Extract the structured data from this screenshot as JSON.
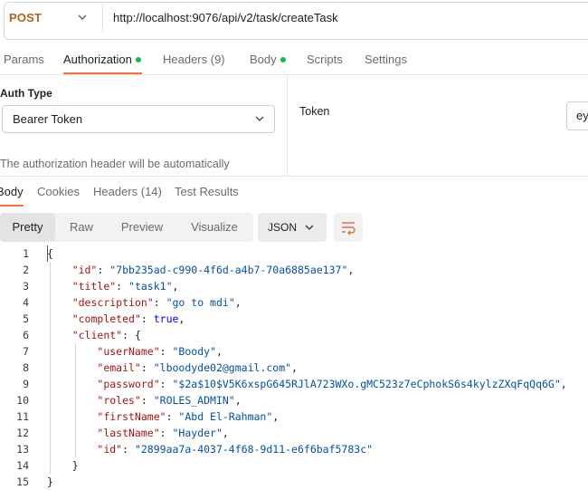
{
  "request": {
    "method": "POST",
    "url": "http://localhost:9076/api/v2/task/createTask"
  },
  "request_tabs": [
    {
      "label": "Params"
    },
    {
      "label": "Authorization"
    },
    {
      "label": "Headers (9)"
    },
    {
      "label": "Body"
    },
    {
      "label": "Scripts"
    },
    {
      "label": "Settings"
    }
  ],
  "auth": {
    "type_label": "Auth Type",
    "type_value": "Bearer Token",
    "description": "The authorization header will be automatically",
    "token_label": "Token",
    "token_value": "ey"
  },
  "response_tabs": [
    {
      "label": "Body"
    },
    {
      "label": "Cookies"
    },
    {
      "label": "Headers (14)"
    },
    {
      "label": "Test Results"
    }
  ],
  "view_modes": [
    {
      "label": "Pretty"
    },
    {
      "label": "Raw"
    },
    {
      "label": "Preview"
    },
    {
      "label": "Visualize"
    }
  ],
  "format": "JSON",
  "colors": {
    "accent": "#ff6c37",
    "method": "#b5621a",
    "dot": "#0cbb52",
    "json_key": "#a31515",
    "json_string": "#0451a5",
    "json_bool": "#0000ff"
  },
  "code_lines": [
    {
      "n": "1",
      "parts": [
        [
          "p",
          "{"
        ]
      ]
    },
    {
      "n": "2",
      "parts": [
        [
          "p",
          "    "
        ],
        [
          "k",
          "\"id\""
        ],
        [
          "p",
          ": "
        ],
        [
          "s",
          "\"7bb235ad-c990-4f6d-a4b7-70a6885ae137\""
        ],
        [
          "p",
          ","
        ]
      ]
    },
    {
      "n": "3",
      "parts": [
        [
          "p",
          "    "
        ],
        [
          "k",
          "\"title\""
        ],
        [
          "p",
          ": "
        ],
        [
          "s",
          "\"task1\""
        ],
        [
          "p",
          ","
        ]
      ]
    },
    {
      "n": "4",
      "parts": [
        [
          "p",
          "    "
        ],
        [
          "k",
          "\"description\""
        ],
        [
          "p",
          ": "
        ],
        [
          "s",
          "\"go to mdi\""
        ],
        [
          "p",
          ","
        ]
      ]
    },
    {
      "n": "5",
      "parts": [
        [
          "p",
          "    "
        ],
        [
          "k",
          "\"completed\""
        ],
        [
          "p",
          ": "
        ],
        [
          "b",
          "true"
        ],
        [
          "p",
          ","
        ]
      ]
    },
    {
      "n": "6",
      "parts": [
        [
          "p",
          "    "
        ],
        [
          "k",
          "\"client\""
        ],
        [
          "p",
          ": {"
        ]
      ]
    },
    {
      "n": "7",
      "parts": [
        [
          "p",
          "        "
        ],
        [
          "k",
          "\"userName\""
        ],
        [
          "p",
          ": "
        ],
        [
          "s",
          "\"Boody\""
        ],
        [
          "p",
          ","
        ]
      ]
    },
    {
      "n": "8",
      "parts": [
        [
          "p",
          "        "
        ],
        [
          "k",
          "\"email\""
        ],
        [
          "p",
          ": "
        ],
        [
          "s",
          "\"lboodyde02@gmail.com\""
        ],
        [
          "p",
          ","
        ]
      ]
    },
    {
      "n": "9",
      "parts": [
        [
          "p",
          "        "
        ],
        [
          "k",
          "\"password\""
        ],
        [
          "p",
          ": "
        ],
        [
          "s",
          "\"$2a$10$V5K6xspG645RJlA723WXo.gMC523z7eCphokS6s4kylzZXqFqQq6G\""
        ],
        [
          "p",
          ","
        ]
      ]
    },
    {
      "n": "10",
      "parts": [
        [
          "p",
          "        "
        ],
        [
          "k",
          "\"roles\""
        ],
        [
          "p",
          ": "
        ],
        [
          "s",
          "\"ROLES_ADMIN\""
        ],
        [
          "p",
          ","
        ]
      ]
    },
    {
      "n": "11",
      "parts": [
        [
          "p",
          "        "
        ],
        [
          "k",
          "\"firstName\""
        ],
        [
          "p",
          ": "
        ],
        [
          "s",
          "\"Abd El-Rahman\""
        ],
        [
          "p",
          ","
        ]
      ]
    },
    {
      "n": "12",
      "parts": [
        [
          "p",
          "        "
        ],
        [
          "k",
          "\"lastName\""
        ],
        [
          "p",
          ": "
        ],
        [
          "s",
          "\"Hayder\""
        ],
        [
          "p",
          ","
        ]
      ]
    },
    {
      "n": "13",
      "parts": [
        [
          "p",
          "        "
        ],
        [
          "k",
          "\"id\""
        ],
        [
          "p",
          ": "
        ],
        [
          "s",
          "\"2899aa7a-4037-4f68-9d11-e6f6baf5783c\""
        ]
      ]
    },
    {
      "n": "14",
      "parts": [
        [
          "p",
          "    }"
        ]
      ]
    },
    {
      "n": "15",
      "parts": [
        [
          "p",
          "}"
        ]
      ]
    }
  ]
}
